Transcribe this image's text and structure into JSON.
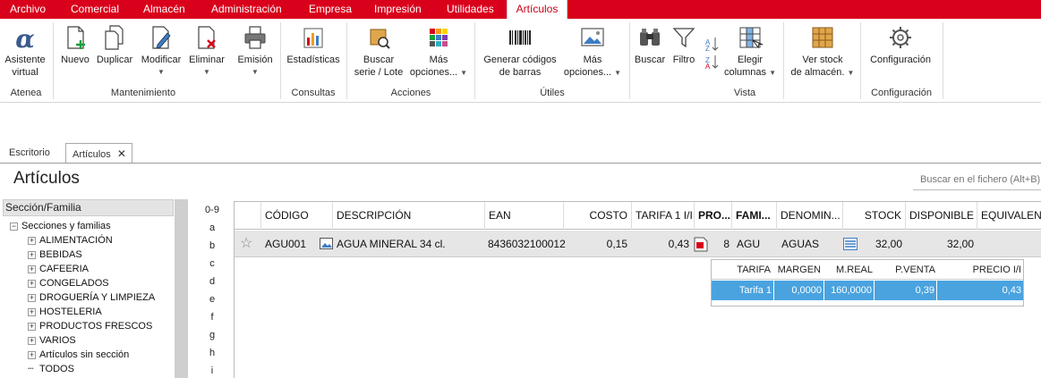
{
  "menubar": {
    "items": [
      "Archivo",
      "Comercial",
      "Almacén",
      "Administración",
      "Empresa",
      "Impresión",
      "Utilidades",
      "Artículos"
    ],
    "active": "Artículos"
  },
  "ribbon": {
    "buttons": {
      "asistente": [
        "Asistente",
        "virtual"
      ],
      "nuevo": "Nuevo",
      "duplicar": "Duplicar",
      "modificar": "Modificar",
      "eliminar": "Eliminar",
      "emision": "Emisión",
      "estadisticas": "Estadísticas",
      "buscar_serie": [
        "Buscar",
        "serie / Lote"
      ],
      "mas_opciones_1": [
        "Más",
        "opciones..."
      ],
      "generar": [
        "Generar códigos",
        "de barras"
      ],
      "mas_opciones_2": [
        "Más",
        "opciones..."
      ],
      "buscar": "Buscar",
      "filtro": "Filtro",
      "elegir": [
        "Elegir",
        "columnas"
      ],
      "ver_stock": [
        "Ver stock",
        "de almacén."
      ],
      "configuracion": "Configuración"
    },
    "groups": {
      "atenea": "Atenea",
      "mantenimiento": "Mantenimiento",
      "consultas": "Consultas",
      "acciones": "Acciones",
      "utiles": "Útiles",
      "vista": "Vista",
      "configuracion": "Configuración"
    },
    "colors": {
      "menubar": "#d9001b",
      "selection": "#4aa3df"
    }
  },
  "tabs": [
    "Escritorio",
    "Artículos"
  ],
  "page": {
    "title": "Artículos",
    "search_placeholder": "Buscar en el fichero (Alt+B)"
  },
  "tree": {
    "header": "Sección/Familia",
    "root": "Secciones y familias",
    "items": [
      "ALIMENTACIÓN",
      "BEBIDAS",
      "CAFEERIA",
      "CONGELADOS",
      "DROGUERÍA Y LIMPIEZA",
      "HOSTELERIA",
      "PRODUCTOS FRESCOS",
      "VARIOS",
      "Artículos sin sección",
      "TODOS"
    ]
  },
  "alpha_index": [
    "0-9",
    "a",
    "b",
    "c",
    "d",
    "e",
    "f",
    "g",
    "h",
    "i"
  ],
  "grid": {
    "columns": [
      "CÓDIGO",
      "DESCRIPCIÓN",
      "EAN",
      "COSTO",
      "TARIFA 1 I/I",
      "PRO...",
      "FAMI...",
      "DENOMIN...",
      "STOCK",
      "DISPONIBLE",
      "EQUIVALEN..."
    ],
    "rows": [
      {
        "codigo": "AGU001",
        "descripcion": "AGUA MINERAL 34 cl.",
        "ean": "8436032100012",
        "costo": "0,15",
        "tarifa": "0,43",
        "pro": "8",
        "familia": "AGU",
        "denominacion": "AGUAS",
        "stock": "32,00",
        "disponible": "32,00"
      }
    ]
  },
  "subgrid": {
    "columns": [
      "TARIFA",
      "MARGEN",
      "M.REAL",
      "P.VENTA",
      "PRECIO I/I"
    ],
    "row": [
      "Tarifa 1",
      "0,0000",
      "160,0000",
      "0,39",
      "0,43"
    ]
  }
}
